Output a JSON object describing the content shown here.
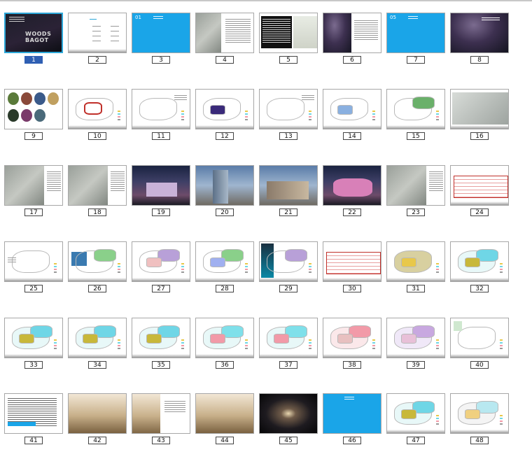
{
  "slides": [
    {
      "number": "1",
      "selected": true,
      "style": "cover",
      "title": "WOODS BAGOT"
    },
    {
      "number": "2",
      "style": "toc"
    },
    {
      "number": "3",
      "style": "section",
      "section_no": "01"
    },
    {
      "number": "4",
      "style": "map-text"
    },
    {
      "number": "5",
      "style": "table-photo"
    },
    {
      "number": "6",
      "style": "sky-text"
    },
    {
      "number": "7",
      "style": "section",
      "section_no": "05"
    },
    {
      "number": "8",
      "style": "sky-photo"
    },
    {
      "number": "9",
      "style": "collage"
    },
    {
      "number": "10",
      "style": "plan-red"
    },
    {
      "number": "11",
      "style": "plan-lines"
    },
    {
      "number": "12",
      "style": "plan-purple"
    },
    {
      "number": "13",
      "style": "plan-lines"
    },
    {
      "number": "14",
      "style": "plan-blue"
    },
    {
      "number": "15",
      "style": "plan-green"
    },
    {
      "number": "16",
      "style": "aerial-gray"
    },
    {
      "number": "17",
      "style": "aerial-text"
    },
    {
      "number": "18",
      "style": "aerial-text"
    },
    {
      "number": "19",
      "style": "night-render"
    },
    {
      "number": "20",
      "style": "tower-render"
    },
    {
      "number": "21",
      "style": "dusk-render"
    },
    {
      "number": "22",
      "style": "night-aerial"
    },
    {
      "number": "23",
      "style": "aerial-text"
    },
    {
      "number": "24",
      "style": "section-red"
    },
    {
      "number": "25",
      "style": "plan-outline"
    },
    {
      "number": "26",
      "style": "plan-photo-green"
    },
    {
      "number": "27",
      "style": "plan-color"
    },
    {
      "number": "28",
      "style": "plan-green-blue"
    },
    {
      "number": "29",
      "style": "plan-photos"
    },
    {
      "number": "30",
      "style": "section-red"
    },
    {
      "number": "31",
      "style": "plan-yellow"
    },
    {
      "number": "32",
      "style": "plan-yellow-cyan"
    },
    {
      "number": "33",
      "style": "plan-yellow-cyan"
    },
    {
      "number": "34",
      "style": "plan-yellow-cyan"
    },
    {
      "number": "35",
      "style": "plan-yellow-cyan"
    },
    {
      "number": "36",
      "style": "plan-cyan-pink"
    },
    {
      "number": "37",
      "style": "plan-cyan-pink"
    },
    {
      "number": "38",
      "style": "plan-pink"
    },
    {
      "number": "39",
      "style": "plan-violet"
    },
    {
      "number": "40",
      "style": "plan-light"
    },
    {
      "number": "41",
      "style": "table"
    },
    {
      "number": "42",
      "style": "interior-render"
    },
    {
      "number": "43",
      "style": "interior-text"
    },
    {
      "number": "44",
      "style": "interior-render"
    },
    {
      "number": "45",
      "style": "galaxy"
    },
    {
      "number": "46",
      "style": "section"
    },
    {
      "number": "47",
      "style": "plan-yellow-cyan"
    },
    {
      "number": "48",
      "style": "plan-outline-cyan"
    }
  ]
}
